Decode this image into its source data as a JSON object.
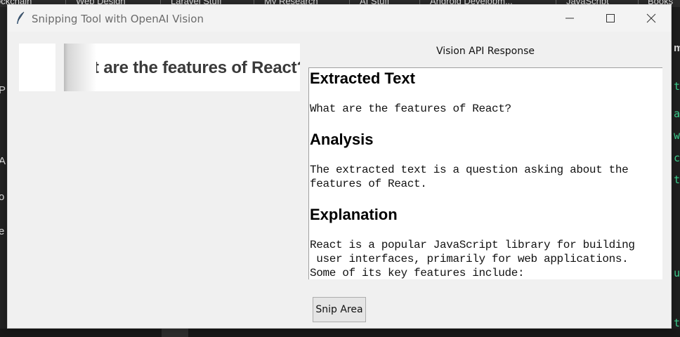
{
  "background": {
    "bookmarks": [
      "ockchain",
      "Web Design",
      "Laravel Stuff",
      "My Research",
      "AI Stuff",
      "Android Developm...",
      "JavaScript",
      "Books"
    ],
    "left_glyphs": [
      "P",
      "A",
      "o",
      "e"
    ],
    "right_glyphs": [
      "t",
      "a",
      "wi",
      "c",
      "th",
      "u",
      "ta"
    ],
    "right_edge_text": "m"
  },
  "window": {
    "title": "Snipping Tool with OpenAI Vision",
    "app_icon": "feather-icon",
    "controls": {
      "minimize": "minimize-icon",
      "maximize": "maximize-icon",
      "close": "close-icon"
    }
  },
  "preview": {
    "captured_text": "What are the features of React?"
  },
  "response": {
    "label": "Vision API Response",
    "heading_extracted": "Extracted Text",
    "extracted_text": "What are the features of React?",
    "heading_analysis": "Analysis",
    "analysis_line1": "The extracted text is a question asking about the",
    "analysis_line2": "features of React.",
    "heading_explanation": "Explanation",
    "explanation_line1": "React is a popular JavaScript library for building",
    "explanation_line2": " user interfaces, primarily for web applications.",
    "explanation_line3": "Some of its key features include:"
  },
  "buttons": {
    "snip_area": "Snip Area"
  },
  "colors": {
    "window_bg": "#f0f0f0",
    "desktop_bg": "#1f1f1f",
    "terminal_green": "#3ccf8e"
  }
}
